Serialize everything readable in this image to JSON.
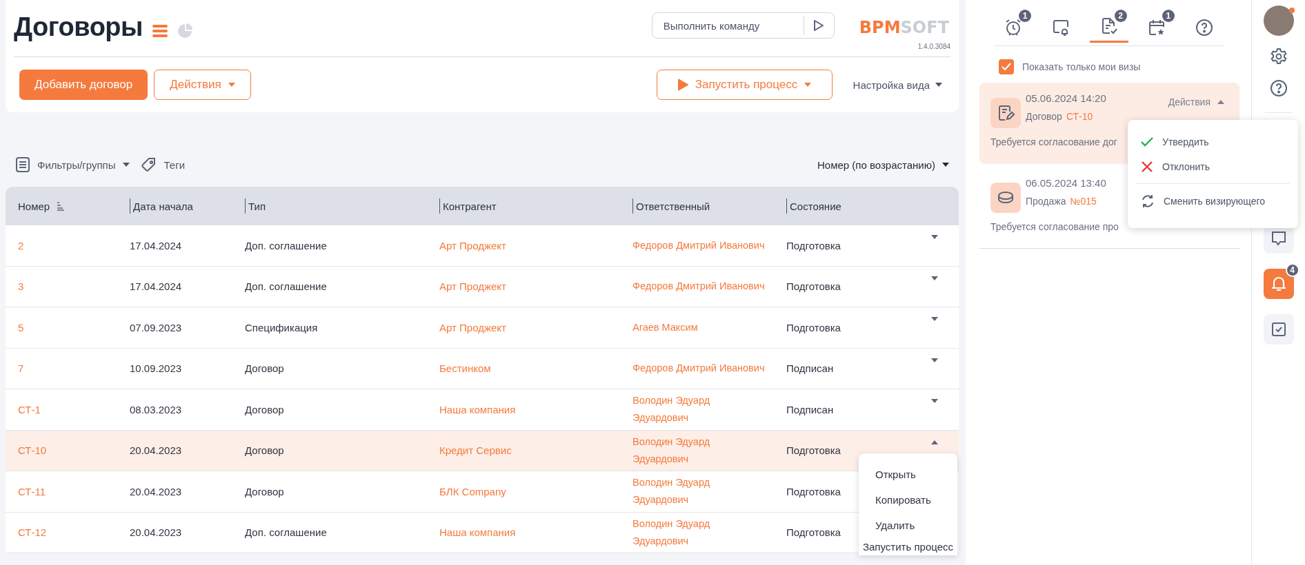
{
  "header": {
    "title": "Договоры",
    "command_field": {
      "placeholder": "Выполнить команду"
    },
    "logo": {
      "part_1": "BPM",
      "part_2": "SOFT"
    },
    "version": "1.4.0.3084"
  },
  "toolbar": {
    "add_button": "Добавить договор",
    "actions_button": "Действия",
    "process_button": "Запустить процесс",
    "view_settings": "Настройка вида"
  },
  "filters": {
    "filters_groups": "Фильтры/группы",
    "tags": "Теги",
    "sort": "Номер (по возрастанию)"
  },
  "table": {
    "columns": [
      "Номер",
      "Дата начала",
      "Тип",
      "Контрагент",
      "Ответственный",
      "Состояние"
    ],
    "rows": [
      {
        "number": "2",
        "start_date": "17.04.2024",
        "type": "Доп. соглашение",
        "counterparty": "Арт Проджект",
        "owner": "Федоров Дмитрий Иванович",
        "status": "Подготовка",
        "selected": false,
        "expanded": false
      },
      {
        "number": "3",
        "start_date": "17.04.2024",
        "type": "Доп. соглашение",
        "counterparty": "Арт Проджект",
        "owner": "Федоров Дмитрий Иванович",
        "status": "Подготовка",
        "selected": false,
        "expanded": false
      },
      {
        "number": "5",
        "start_date": "07.09.2023",
        "type": "Спецификация",
        "counterparty": "Арт Проджект",
        "owner": "Агаев Максим",
        "status": "Подготовка",
        "selected": false,
        "expanded": false
      },
      {
        "number": "7",
        "start_date": "10.09.2023",
        "type": "Договор",
        "counterparty": "Бестинком",
        "owner": "Федоров Дмитрий Иванович",
        "status": "Подписан",
        "selected": false,
        "expanded": false
      },
      {
        "number": "СТ-1",
        "start_date": "08.03.2023",
        "type": "Договор",
        "counterparty": "Наша компания",
        "owner": "Володин Эдуард Эдуардович",
        "status": "Подписан",
        "selected": false,
        "expanded": false
      },
      {
        "number": "СТ-10",
        "start_date": "20.04.2023",
        "type": "Договор",
        "counterparty": "Кредит Сервис",
        "owner": "Володин Эдуард Эдуардович",
        "status": "Подготовка",
        "selected": true,
        "expanded": true
      },
      {
        "number": "СТ-11",
        "start_date": "20.04.2023",
        "type": "Договор",
        "counterparty": "БЛК Company",
        "owner": "Володин Эдуард Эдуардович",
        "status": "Подготовка",
        "selected": false
      },
      {
        "number": "СТ-12",
        "start_date": "20.04.2023",
        "type": "Доп. соглашение",
        "counterparty": "Наша компания",
        "owner": "Володин Эдуард Эдуардович",
        "status": "Подготовка",
        "selected": false
      }
    ]
  },
  "row_menu": {
    "items": [
      "Открыть",
      "Копировать",
      "Удалить",
      "Запустить процесс"
    ]
  },
  "visa_panel": {
    "tabs": [
      {
        "kind": "alarm",
        "badge": "1",
        "selected": false
      },
      {
        "kind": "monitor-bell",
        "selected": false
      },
      {
        "kind": "doc-check",
        "badge": "2",
        "selected": true
      },
      {
        "kind": "calendar-star",
        "badge": "1",
        "selected": false
      },
      {
        "kind": "help",
        "selected": false
      }
    ],
    "only_mine": {
      "label": "Показать только мои визы",
      "checked": true
    },
    "cards": [
      {
        "kind": "contract",
        "datetime": "05.06.2024 14:20",
        "entity": "Договор",
        "link": "СТ-10",
        "description": "Требуется согласование дог",
        "actions": "Действия",
        "selected": true
      },
      {
        "kind": "sale",
        "datetime": "06.05.2024 13:40",
        "entity": "Продажа",
        "link": "№015",
        "description": "Требуется согласование про",
        "selected": false
      }
    ],
    "actions_menu": [
      {
        "kind": "approve",
        "label": "Утвердить"
      },
      {
        "kind": "reject",
        "label": "Отклонить"
      },
      {
        "kind": "reassign",
        "label": "Сменить визирующего"
      }
    ]
  },
  "rail": {
    "items": [
      {
        "kind": "avatar"
      },
      {
        "kind": "settings",
        "selected": false
      },
      {
        "kind": "help",
        "selected": false
      },
      {
        "kind": "chat",
        "selected": false
      },
      {
        "kind": "bell",
        "badge": "4",
        "selected": true
      },
      {
        "kind": "checklist",
        "selected": false
      }
    ]
  }
}
